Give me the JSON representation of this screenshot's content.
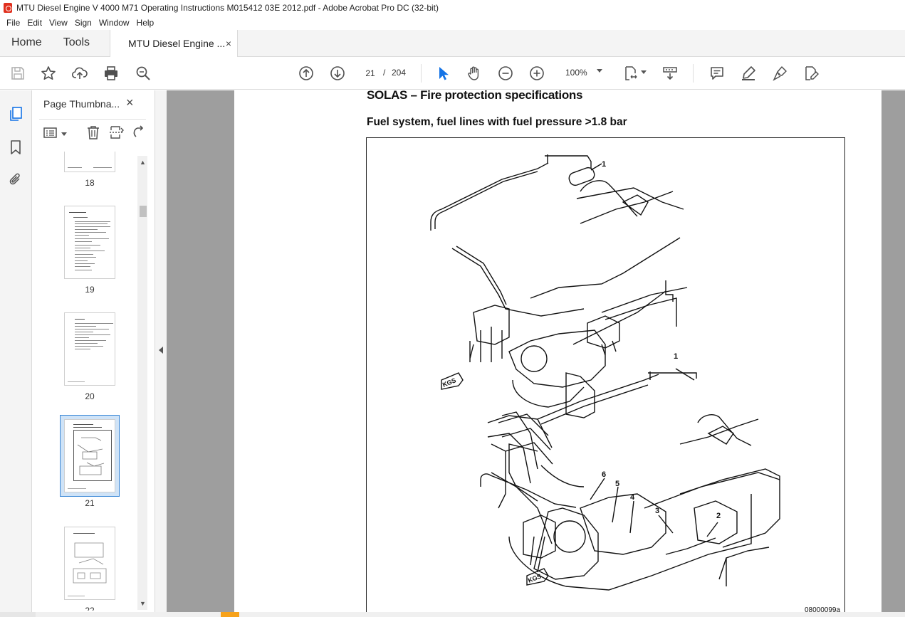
{
  "window": {
    "title": "MTU Diesel Engine V 4000 M71 Operating Instructions M015412 03E 2012.pdf - Adobe Acrobat Pro DC (32-bit)"
  },
  "menu": [
    "File",
    "Edit",
    "View",
    "Sign",
    "Window",
    "Help"
  ],
  "tabs": {
    "home": "Home",
    "tools": "Tools",
    "document": "MTU Diesel Engine ...",
    "close_glyph": "×"
  },
  "toolbar": {
    "current_page": "21",
    "page_separator": "/",
    "total_pages": "204",
    "zoom": "100%",
    "icons": [
      "save-icon",
      "bookmark-star-icon",
      "upload-icon",
      "print-icon",
      "zoom-search-icon",
      "page-up-icon",
      "page-down-icon",
      "select-cursor-icon",
      "hand-icon",
      "zoom-out-icon",
      "zoom-in-icon",
      "page-fit-icon",
      "scroll-mode-icon",
      "comment-icon",
      "highlight-pen-icon",
      "sign-icon",
      "fill-sign-icon"
    ]
  },
  "sidebar": {
    "panel_title": "Page Thumbna...",
    "close_glyph": "×",
    "thumbnails": [
      {
        "label": "18"
      },
      {
        "label": "19"
      },
      {
        "label": "20"
      },
      {
        "label": "21",
        "selected": true
      },
      {
        "label": "22"
      }
    ]
  },
  "document": {
    "section_heading": "SOLAS – Fire protection specifications",
    "sub_heading": "Fuel system, fuel lines with fuel pressure >1.8 bar",
    "figure_labels": [
      "1",
      "1",
      "2",
      "3",
      "4",
      "5",
      "6",
      "KGS",
      "KGS"
    ],
    "figure_code": "08000099a"
  },
  "colors": {
    "accent": "#3a87d6",
    "selected_thumb_bg": "#cfe3f7",
    "app_red": "#e0301e",
    "select_tool": "#1473e6"
  }
}
